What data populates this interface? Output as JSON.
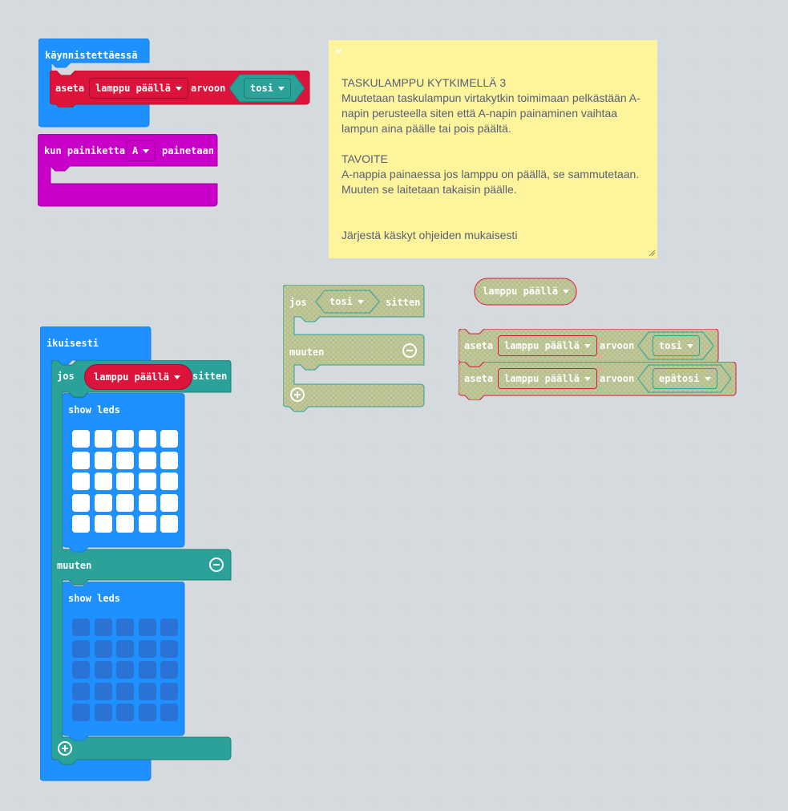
{
  "colors": {
    "loops": "#1e90ff",
    "variables": "#dc143c",
    "logic": "#2aa199",
    "input": "#c800c8",
    "basic": "#1e90ff",
    "note": "#fef49c",
    "disabled_fill": "#c9c888"
  },
  "on_start": {
    "label": "käynnistettäessä"
  },
  "set_block_1": {
    "aseta": "aseta",
    "variable": "lamppu päällä",
    "arvoon": "arvoon",
    "value": "tosi"
  },
  "button_block": {
    "label": "kun painiketta",
    "button": "A",
    "suffix": "painetaan"
  },
  "note": {
    "text": "TASKULAMPPU KYTKIMELLÄ 3\nMuutetaan taskulampun virtakytkin toimimaan pelkästään A-napin perusteella siten että A-napin painaminen vaihtaa lampun aina päälle tai pois päältä.\n\nTAVOITE\nA-nappia painaessa jos lamppu on päällä, se sammutetaan. Muuten se laitetaan takaisin päälle.\n\n\nJärjestä käskyt ohjeiden mukaisesti"
  },
  "forever": {
    "label": "ikuisesti",
    "if_label": "jos",
    "condition": "lamppu päällä",
    "then_label": "sitten",
    "show_leds_1": "show leds",
    "else_label": "muuten",
    "show_leds_2": "show leds",
    "leds_1": [
      [
        1,
        1,
        1,
        1,
        1
      ],
      [
        1,
        1,
        1,
        1,
        1
      ],
      [
        1,
        1,
        1,
        1,
        1
      ],
      [
        1,
        1,
        1,
        1,
        1
      ],
      [
        1,
        1,
        1,
        1,
        1
      ]
    ],
    "leds_2": [
      [
        0,
        0,
        0,
        0,
        0
      ],
      [
        0,
        0,
        0,
        0,
        0
      ],
      [
        0,
        0,
        0,
        0,
        0
      ],
      [
        0,
        0,
        0,
        0,
        0
      ],
      [
        0,
        0,
        0,
        0,
        0
      ]
    ]
  },
  "loose_if": {
    "if_label": "jos",
    "condition": "tosi",
    "then_label": "sitten",
    "else_label": "muuten"
  },
  "loose_var": {
    "variable": "lamppu päällä"
  },
  "loose_set_1": {
    "aseta": "aseta",
    "variable": "lamppu päällä",
    "arvoon": "arvoon",
    "value": "tosi"
  },
  "loose_set_2": {
    "aseta": "aseta",
    "variable": "lamppu päällä",
    "arvoon": "arvoon",
    "value": "epätosi"
  }
}
